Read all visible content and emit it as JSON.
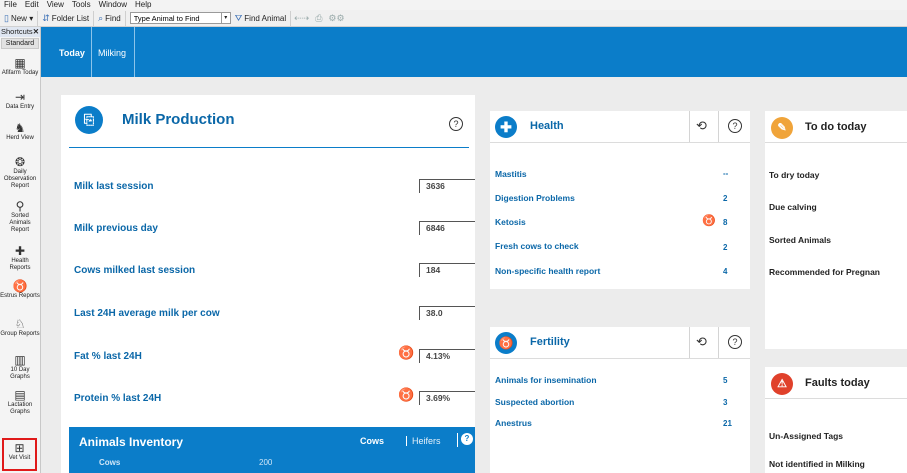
{
  "menu": [
    "File",
    "Edit",
    "View",
    "Tools",
    "Window",
    "Help"
  ],
  "toolbar": {
    "new_label": "New",
    "folder_list_label": "Folder List",
    "find_label": "Find",
    "find_placeholder": "Type Animal to Find",
    "find_animal_label": "Find Animal"
  },
  "sidebar": {
    "header": "Shortcuts",
    "close": "✕",
    "standard": "Standard",
    "items": [
      {
        "label": "Afifarm Today",
        "icon": "afifarm-today-icon"
      },
      {
        "label": "Data Entry",
        "icon": "data-entry-icon"
      },
      {
        "label": "Herd View",
        "icon": "herd-view-icon"
      },
      {
        "label": "Daily Observation Report",
        "icon": "daily-observation-icon"
      },
      {
        "label": "Sorted Animals Report",
        "icon": "sorted-animals-icon"
      },
      {
        "label": "Health Reports",
        "icon": "health-reports-icon"
      },
      {
        "label": "Estrus Reports",
        "icon": "estrus-reports-icon"
      },
      {
        "label": "Group Reports",
        "icon": "group-reports-icon"
      },
      {
        "label": "10 Day Graphs",
        "icon": "ten-day-graphs-icon"
      },
      {
        "label": "Lactation Graphs",
        "icon": "lactation-graphs-icon"
      },
      {
        "label": "Vet Visit",
        "icon": "vet-visit-icon"
      }
    ]
  },
  "tabs": {
    "today": "Today",
    "milking": "Milking"
  },
  "milk": {
    "title": "Milk Production",
    "help": "?",
    "rows": [
      {
        "label": "Milk last session",
        "value": "3636"
      },
      {
        "label": "Milk previous day",
        "value": "6846"
      },
      {
        "label": "Cows milked last session",
        "value": "184"
      },
      {
        "label": "Last 24H average milk per cow",
        "value": "38.0"
      },
      {
        "label": "Fat % last 24H",
        "value": "4.13%"
      },
      {
        "label": "Protein % last 24H",
        "value": "3.69%"
      }
    ]
  },
  "inventory": {
    "title": "Animals Inventory",
    "cows": "Cows",
    "heifers": "Heifers",
    "help": "?",
    "row_label": "Cows",
    "row_value": "200"
  },
  "health": {
    "title": "Health",
    "help": "?",
    "rows": [
      {
        "label": "Mastitis",
        "value": "--"
      },
      {
        "label": "Digestion Problems",
        "value": "2"
      },
      {
        "label": "Ketosis",
        "value": "8"
      },
      {
        "label": "Fresh cows to check",
        "value": "2"
      },
      {
        "label": "Non-specific health report",
        "value": "4"
      }
    ]
  },
  "fertility": {
    "title": "Fertility",
    "help": "?",
    "rows": [
      {
        "label": "Animals for insemination",
        "value": "5"
      },
      {
        "label": "Suspected abortion",
        "value": "3"
      },
      {
        "label": "Anestrus",
        "value": "21"
      }
    ]
  },
  "todo": {
    "title": "To do today",
    "rows": [
      "To dry today",
      "Due calving",
      "Sorted Animals",
      "Recommended for Pregnan"
    ]
  },
  "faults": {
    "title": "Faults today",
    "rows": [
      "Un-Assigned Tags",
      "Not identified in Milking"
    ]
  },
  "colors": {
    "accent": "#0b7dc9",
    "todo": "#f0a43a",
    "faults": "#e0412b"
  }
}
